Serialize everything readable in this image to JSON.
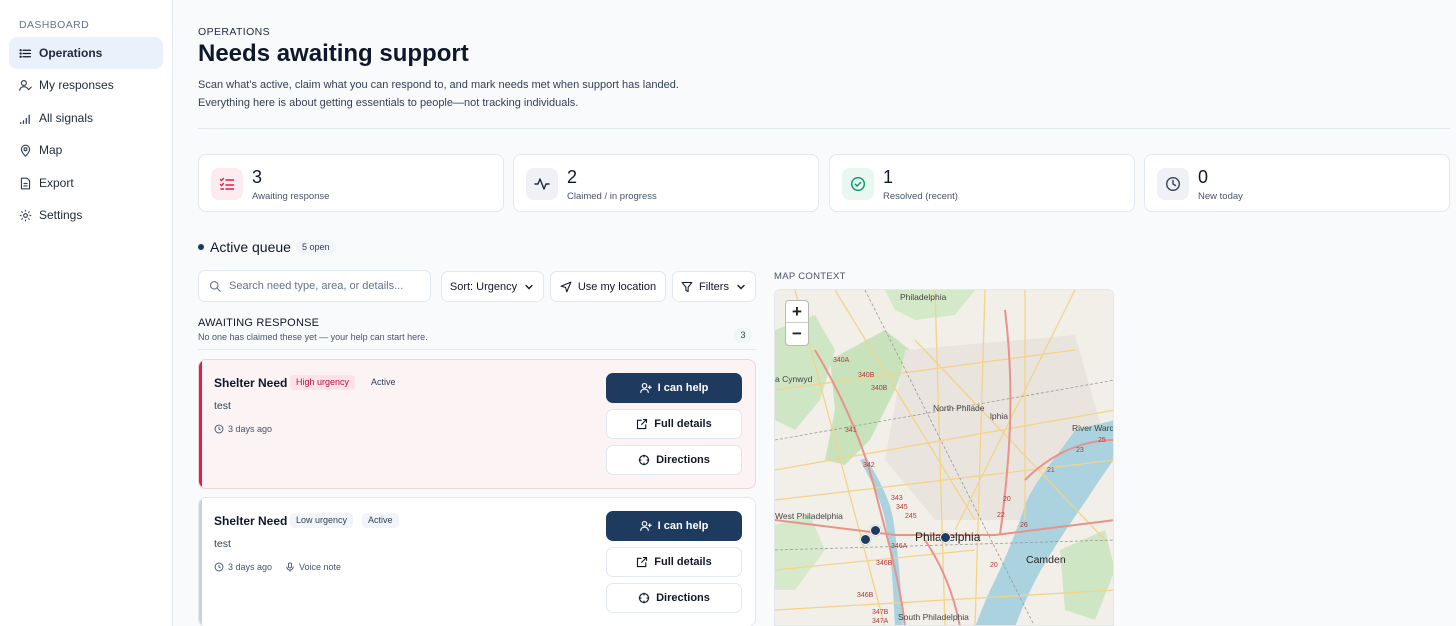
{
  "sidebar": {
    "section_label": "DASHBOARD",
    "items": [
      {
        "label": "Operations",
        "icon": "list-icon",
        "active": true
      },
      {
        "label": "My responses",
        "icon": "user-check-icon"
      },
      {
        "label": "All signals",
        "icon": "signal-bars-icon"
      },
      {
        "label": "Map",
        "icon": "map-pin-icon"
      },
      {
        "label": "Export",
        "icon": "document-icon"
      },
      {
        "label": "Settings",
        "icon": "gear-icon"
      }
    ]
  },
  "header": {
    "kicker": "OPERATIONS",
    "title": "Needs awaiting support",
    "subtitle_line1": "Scan what's active, claim what you can respond to, and mark needs met when support has landed.",
    "subtitle_line2": "Everything here is about getting essentials to people—not tracking individuals."
  },
  "stats": [
    {
      "value": "3",
      "label": "Awaiting response",
      "icon": "list-check-icon",
      "color": "#e11d48"
    },
    {
      "value": "2",
      "label": "Claimed / in progress",
      "icon": "activity-icon",
      "color": "#1e3a5f"
    },
    {
      "value": "1",
      "label": "Resolved (recent)",
      "icon": "check-circle-icon",
      "color": "#059669"
    },
    {
      "value": "0",
      "label": "New today",
      "icon": "clock-icon",
      "color": "#334155"
    }
  ],
  "queue": {
    "title": "Active queue",
    "badge": "5 open"
  },
  "toolbar": {
    "search_placeholder": "Search need type, area, or details...",
    "search_value": "",
    "sort_label": "Sort: Urgency",
    "location_label": "Use my location",
    "filters_label": "Filters"
  },
  "awaiting": {
    "title": "AWAITING RESPONSE",
    "subtitle": "No one has claimed these yet — your help can start here.",
    "count": "3"
  },
  "needs": [
    {
      "title": "Shelter Need",
      "urgency": "High urgency",
      "status": "Active",
      "description": "test",
      "time": "3 days ago",
      "extra": ""
    },
    {
      "title": "Shelter Need",
      "urgency": "Low urgency",
      "status": "Active",
      "description": "test",
      "time": "3 days ago",
      "extra": "Voice note"
    }
  ],
  "actions": {
    "help": "I can help",
    "details": "Full details",
    "directions": "Directions"
  },
  "map": {
    "label": "MAP CONTEXT",
    "zoom_in": "+",
    "zoom_out": "−",
    "places": {
      "philadelphia_top": "Philadelphia",
      "cynwyd": "a Cynwyd",
      "north_philadelphia": "North Philade",
      "north_philadelphia_suffix": "lphia",
      "river_ward": "River Ward",
      "west_philadelphia": "West Philadelphia",
      "philadelphia": "Philadelphia",
      "camden": "Camden",
      "south_philadelphia": "South Philadelphia"
    },
    "route_labels": [
      "340A",
      "340B",
      "340B",
      "341",
      "342",
      "343",
      "345",
      "245",
      "346A",
      "346B",
      "346B",
      "347B",
      "347A",
      "25",
      "23",
      "21",
      "20",
      "20",
      "22",
      "26"
    ]
  }
}
